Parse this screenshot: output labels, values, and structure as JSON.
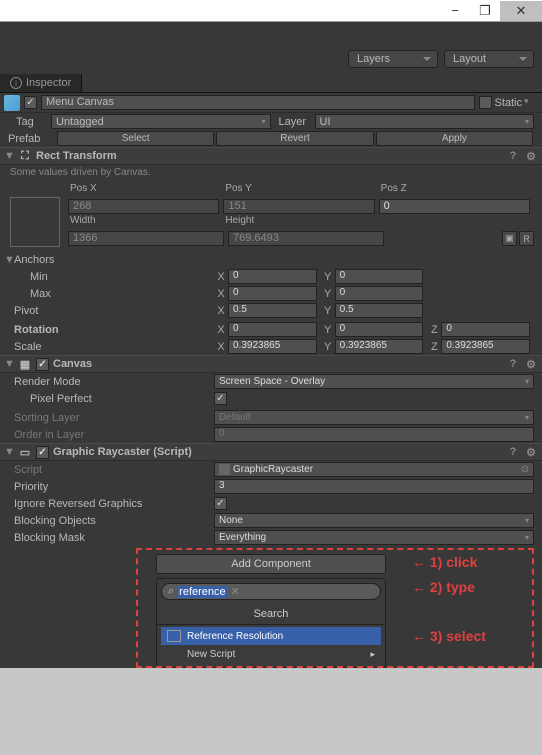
{
  "chrome": {
    "min": "−",
    "max": "❐",
    "close": "✕"
  },
  "toolbar": {
    "layers": "Layers",
    "layout": "Layout"
  },
  "tab": {
    "inspector": "Inspector"
  },
  "object": {
    "name": "Menu Canvas",
    "static_label": "Static",
    "tag_label": "Tag",
    "tag_value": "Untagged",
    "layer_label": "Layer",
    "layer_value": "UI"
  },
  "prefab": {
    "label": "Prefab",
    "select": "Select",
    "revert": "Revert",
    "apply": "Apply"
  },
  "rect": {
    "title": "Rect Transform",
    "hint": "Some values driven by Canvas.",
    "posx_l": "Pos X",
    "posy_l": "Pos Y",
    "posz_l": "Pos Z",
    "posx": "268",
    "posy": "151",
    "posz": "0",
    "width_l": "Width",
    "height_l": "Height",
    "width": "1366",
    "height": "769.6493",
    "anchors_l": "Anchors",
    "min_l": "Min",
    "min_x": "0",
    "min_y": "0",
    "max_l": "Max",
    "max_x": "0",
    "max_y": "0",
    "pivot_l": "Pivot",
    "pivot_x": "0.5",
    "pivot_y": "0.5",
    "rotation_l": "Rotation",
    "rot_x": "0",
    "rot_y": "0",
    "rot_z": "0",
    "scale_l": "Scale",
    "scale_x": "0.3923865",
    "scale_y": "0.3923865",
    "scale_z": "0.3923865",
    "btn_b": "▣",
    "btn_r": "R"
  },
  "canvas": {
    "title": "Canvas",
    "render_mode_l": "Render Mode",
    "render_mode": "Screen Space - Overlay",
    "pixel_perfect_l": "Pixel Perfect",
    "sorting_layer_l": "Sorting Layer",
    "sorting_layer": "Default",
    "order_l": "Order in Layer",
    "order": "0"
  },
  "raycaster": {
    "title": "Graphic Raycaster (Script)",
    "script_l": "Script",
    "script": "GraphicRaycaster",
    "priority_l": "Priority",
    "priority": "3",
    "ignore_l": "Ignore Reversed Graphics",
    "blocking_obj_l": "Blocking Objects",
    "blocking_obj": "None",
    "blocking_mask_l": "Blocking Mask",
    "blocking_mask": "Everything"
  },
  "add": {
    "button": "Add Component",
    "search_text": "reference",
    "title": "Search",
    "item_ref": "Reference Resolution",
    "item_new": "New Script"
  },
  "annot": {
    "a1": "← 1) click",
    "a2": "← 2) type",
    "a3": "← 3) select"
  }
}
